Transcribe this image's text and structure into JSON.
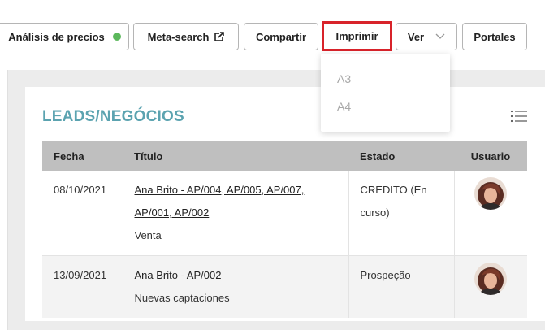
{
  "toolbar": {
    "precios_label": "Análisis de precios",
    "meta_label": "Meta-search",
    "compartir_label": "Compartir",
    "imprimir_label": "Imprimir",
    "ver_label": "Ver",
    "portales_label": "Portales",
    "status_color": "#5cb85c",
    "highlight_color": "#d8232a"
  },
  "print_menu": {
    "items": [
      "A3",
      "A4"
    ]
  },
  "leads": {
    "title": "LEADS/NEGÓCIOS",
    "title_color": "#5ba3b0",
    "columns": [
      "Fecha",
      "Título",
      "Estado",
      "Usuario"
    ],
    "rows": [
      {
        "fecha": "08/10/2021",
        "titulo_line1": "Ana Brito - AP/004, AP/005, AP/007,",
        "titulo_line2": "AP/001, AP/002",
        "tipo": "Venta",
        "estado_line1": "CREDITO (En",
        "estado_line2": "curso)"
      },
      {
        "fecha": "13/09/2021",
        "titulo_line1": "Ana Brito - AP/002",
        "tipo": "Nuevas captaciones",
        "estado_line1": "Prospeção"
      }
    ]
  }
}
